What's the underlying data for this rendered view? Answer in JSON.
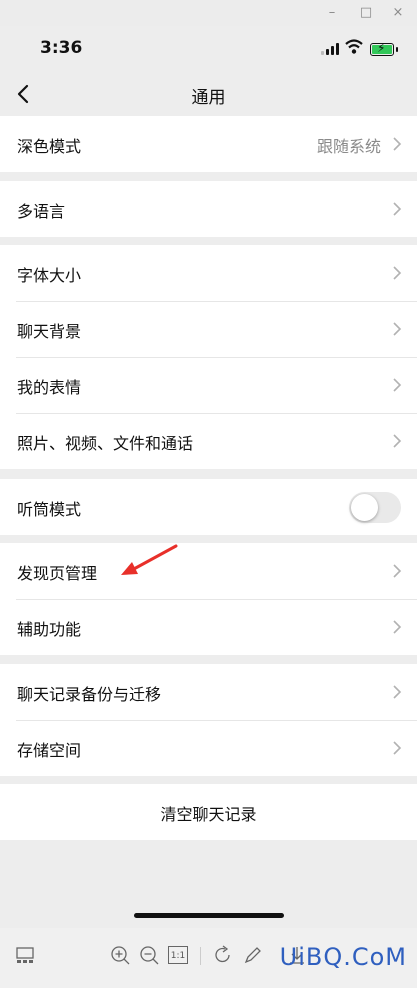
{
  "window": {
    "minimize": "–",
    "maximize": "□",
    "close": "×"
  },
  "status": {
    "time": "3:36"
  },
  "nav": {
    "title": "通用"
  },
  "groups": [
    [
      {
        "label": "深色模式",
        "value": "跟随系统"
      }
    ],
    [
      {
        "label": "多语言"
      }
    ],
    [
      {
        "label": "字体大小"
      },
      {
        "label": "聊天背景"
      },
      {
        "label": "我的表情"
      },
      {
        "label": "照片、视频、文件和通话"
      }
    ],
    [
      {
        "label": "听筒模式",
        "toggle": false
      }
    ],
    [
      {
        "label": "发现页管理"
      },
      {
        "label": "辅助功能"
      }
    ],
    [
      {
        "label": "聊天记录备份与迁移"
      },
      {
        "label": "存储空间"
      }
    ],
    [
      {
        "label": "清空聊天记录"
      }
    ]
  ],
  "toolbar": {
    "zoom_ratio": "1:1"
  },
  "watermark": "UiBQ.CoM",
  "colors": {
    "annotation_arrow": "#e8302a",
    "toggle_off": "#e9e9e9",
    "battery": "#32c759"
  }
}
